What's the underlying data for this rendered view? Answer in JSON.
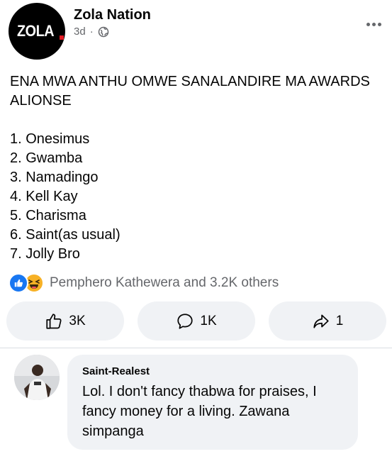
{
  "post": {
    "page_name": "Zola Nation",
    "logo_text": "ZOLA",
    "time": "3d",
    "separator": "·",
    "headline": "ENA MWA ANTHU OMWE SANALANDIRE MA AWARDS ALIONSE",
    "list": [
      "1. Onesimus",
      "2. Gwamba",
      "3. Namadingo",
      "4. Kell Kay",
      "5. Charisma",
      "6. Saint(as usual)",
      "7. Jolly Bro"
    ],
    "reactions_text": "Pemphero Kathewera and 3.2K others"
  },
  "actions": {
    "like_count": "3K",
    "comment_count": "1K",
    "share_count": "1"
  },
  "comment": {
    "author": "Saint-Realest",
    "text": "Lol. I don't fancy thabwa for praises, I fancy money for a living.  Zawana simpanga"
  },
  "colors": {
    "like_blue": "#1877f2",
    "haha_yellow": "#f7b125",
    "logo_red": "#e21b23",
    "secondary_text": "#65676b",
    "button_bg": "#f0f2f5"
  }
}
